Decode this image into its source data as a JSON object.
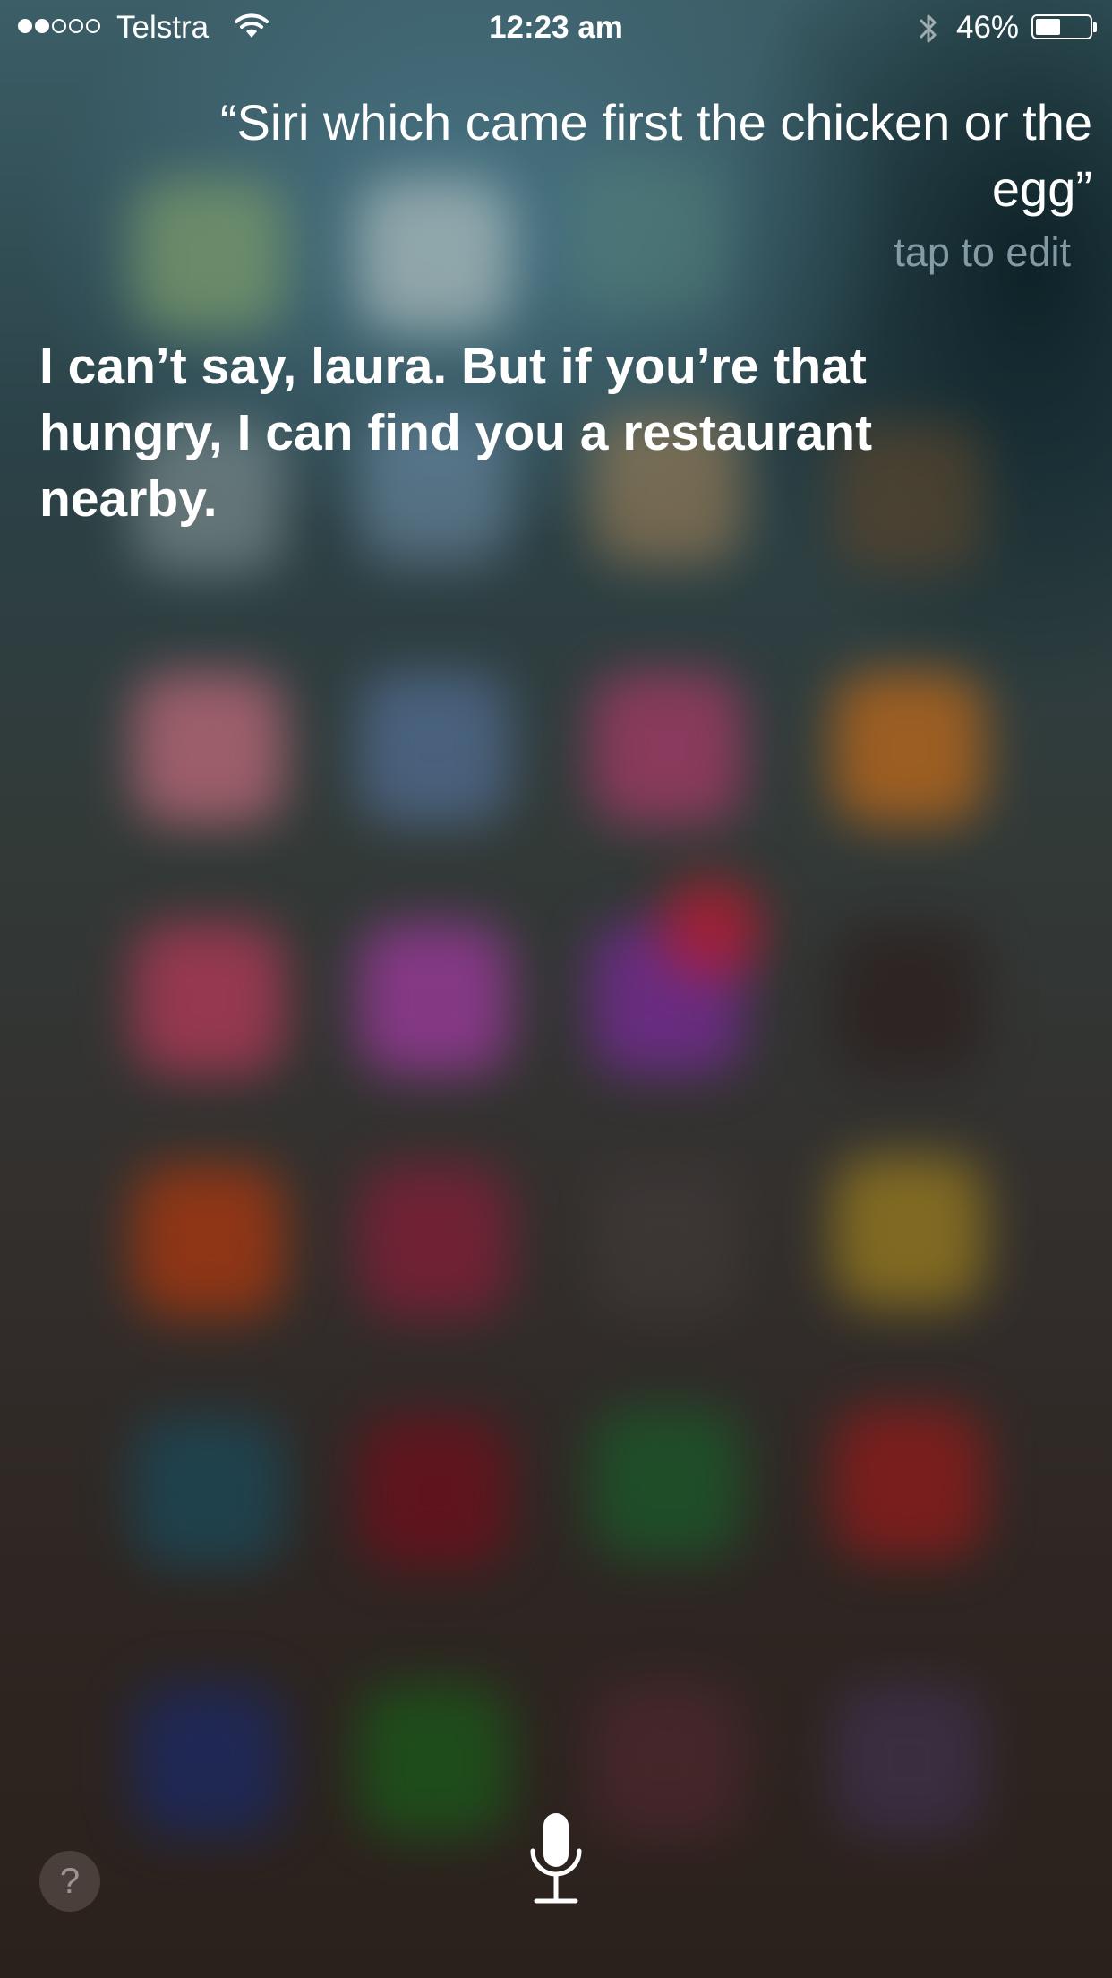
{
  "status_bar": {
    "signal_strength": 2,
    "signal_max": 5,
    "carrier": "Telstra",
    "wifi_icon": "wifi-icon",
    "time": "12:23 am",
    "bluetooth_icon": "bluetooth-icon",
    "battery_percent_text": "46%",
    "battery_level": 0.46
  },
  "siri": {
    "query": "“Siri which came first the chicken or the egg”",
    "tap_to_edit": "tap to edit",
    "response": "I can’t say, laura. But if you’re that hungry, I can find you a restaurant nearby.",
    "help_label": "?",
    "help_icon": "question-icon",
    "mic_icon": "microphone-icon"
  },
  "colors": {
    "text": "#ffffff",
    "tap_to_edit": "#96afb9"
  }
}
